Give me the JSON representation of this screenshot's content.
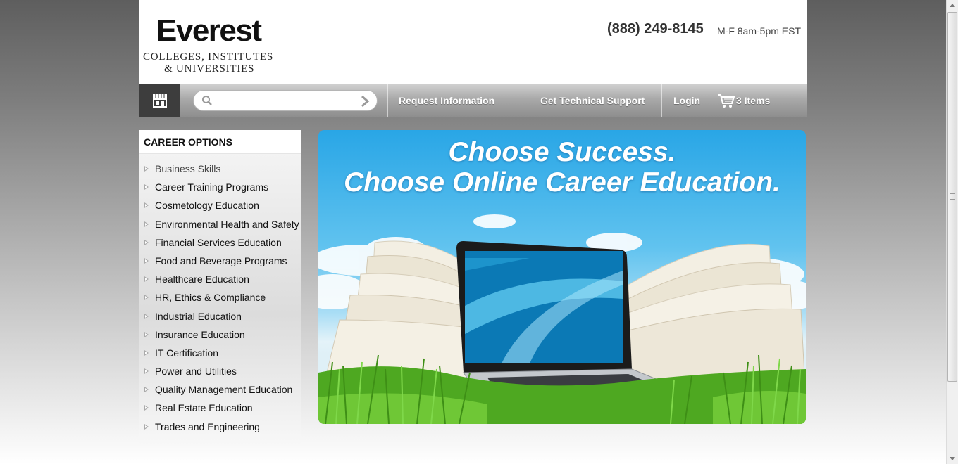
{
  "header": {
    "logo_main": "Everest",
    "logo_sub_line1": "COLLEGES, INSTITUTES",
    "logo_sub_line2": "& UNIVERSITIES",
    "phone": "(888) 249-8145",
    "hours": "M-F 8am-5pm EST"
  },
  "nav": {
    "store_icon": "storefront-icon",
    "search": {
      "placeholder": "",
      "value": ""
    },
    "links": {
      "request_info": "Request Information",
      "support": "Get Technical Support",
      "login": "Login",
      "cart": "3 Items"
    }
  },
  "sidebar": {
    "title": "CAREER OPTIONS",
    "items": [
      "Business Skills",
      "Career Training Programs",
      "Cosmetology Education",
      "Environmental Health and Safety",
      "Financial Services Education",
      "Food and Beverage Programs",
      "Healthcare Education",
      "HR, Ethics & Compliance",
      "Industrial Education",
      "Insurance Education",
      "IT Certification",
      "Power and Utilities",
      "Quality Management Education",
      "Real Estate Education",
      "Trades and Engineering"
    ]
  },
  "hero": {
    "line1": "Choose Success.",
    "line2": "Choose Online Career Education."
  },
  "colors": {
    "nav_dark": "#3d3d3d",
    "hero_sky": "#29a6e6",
    "grass": "#5fb82a"
  }
}
